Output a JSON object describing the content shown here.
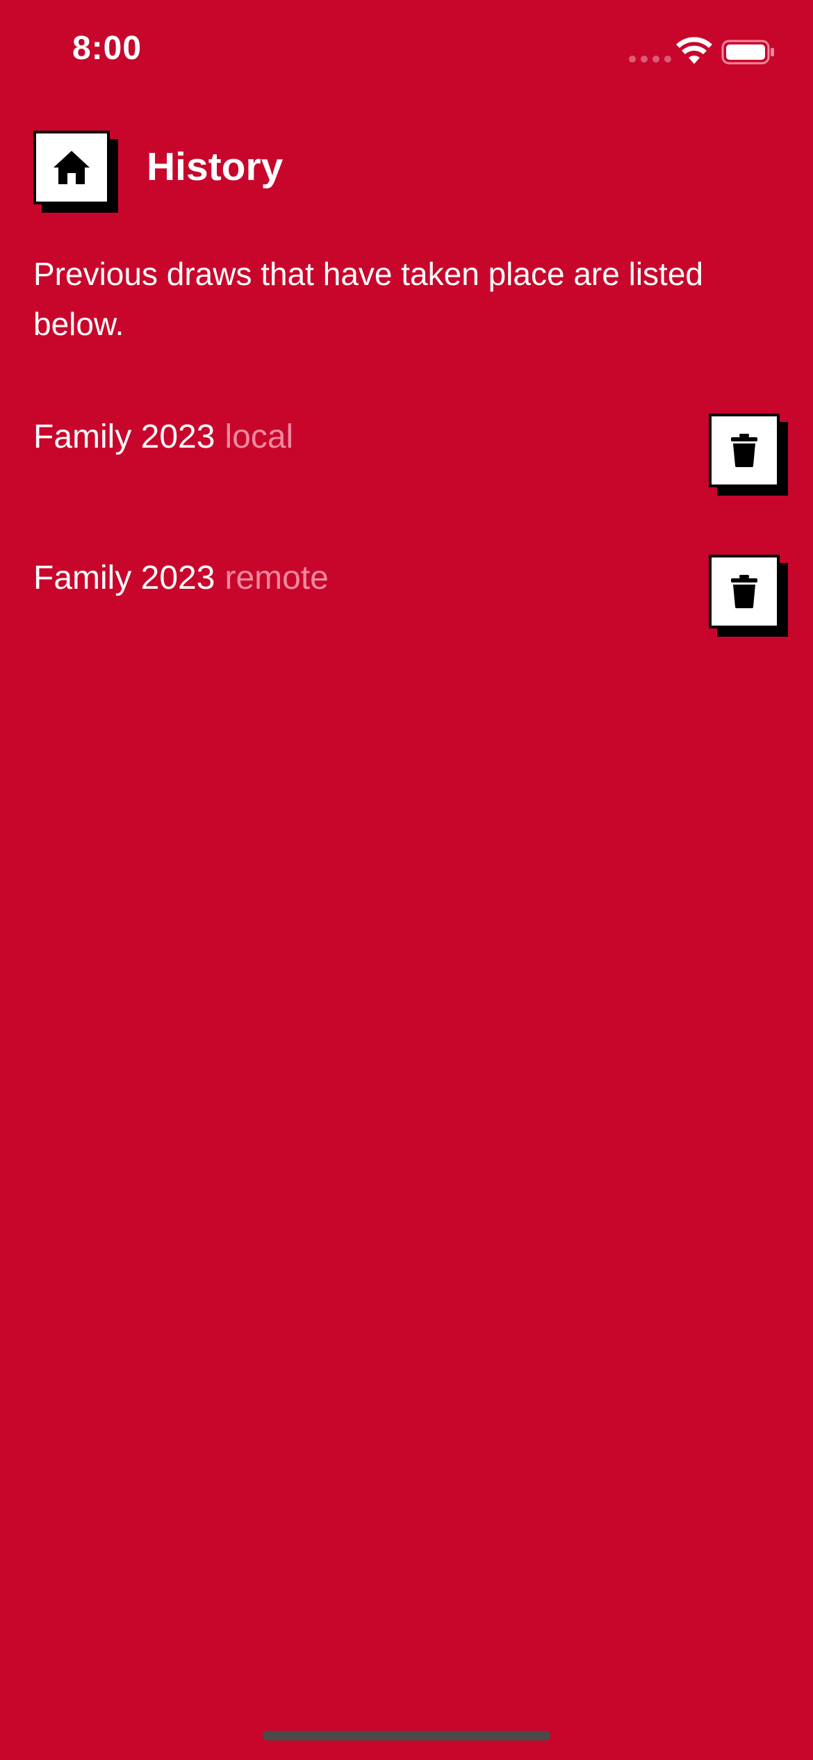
{
  "status_bar": {
    "time": "8:00"
  },
  "header": {
    "title": "History",
    "home_icon": "home-icon"
  },
  "description": "Previous draws that have taken place are listed below.",
  "history": {
    "items": [
      {
        "name": "Family 2023",
        "source": "local",
        "action_icon": "trash-icon"
      },
      {
        "name": "Family 2023",
        "source": "remote",
        "action_icon": "trash-icon"
      }
    ]
  },
  "colors": {
    "background": "#c8062b",
    "source_label": "#f1899e",
    "button_bg": "#ffffff",
    "button_shadow": "#000000"
  }
}
